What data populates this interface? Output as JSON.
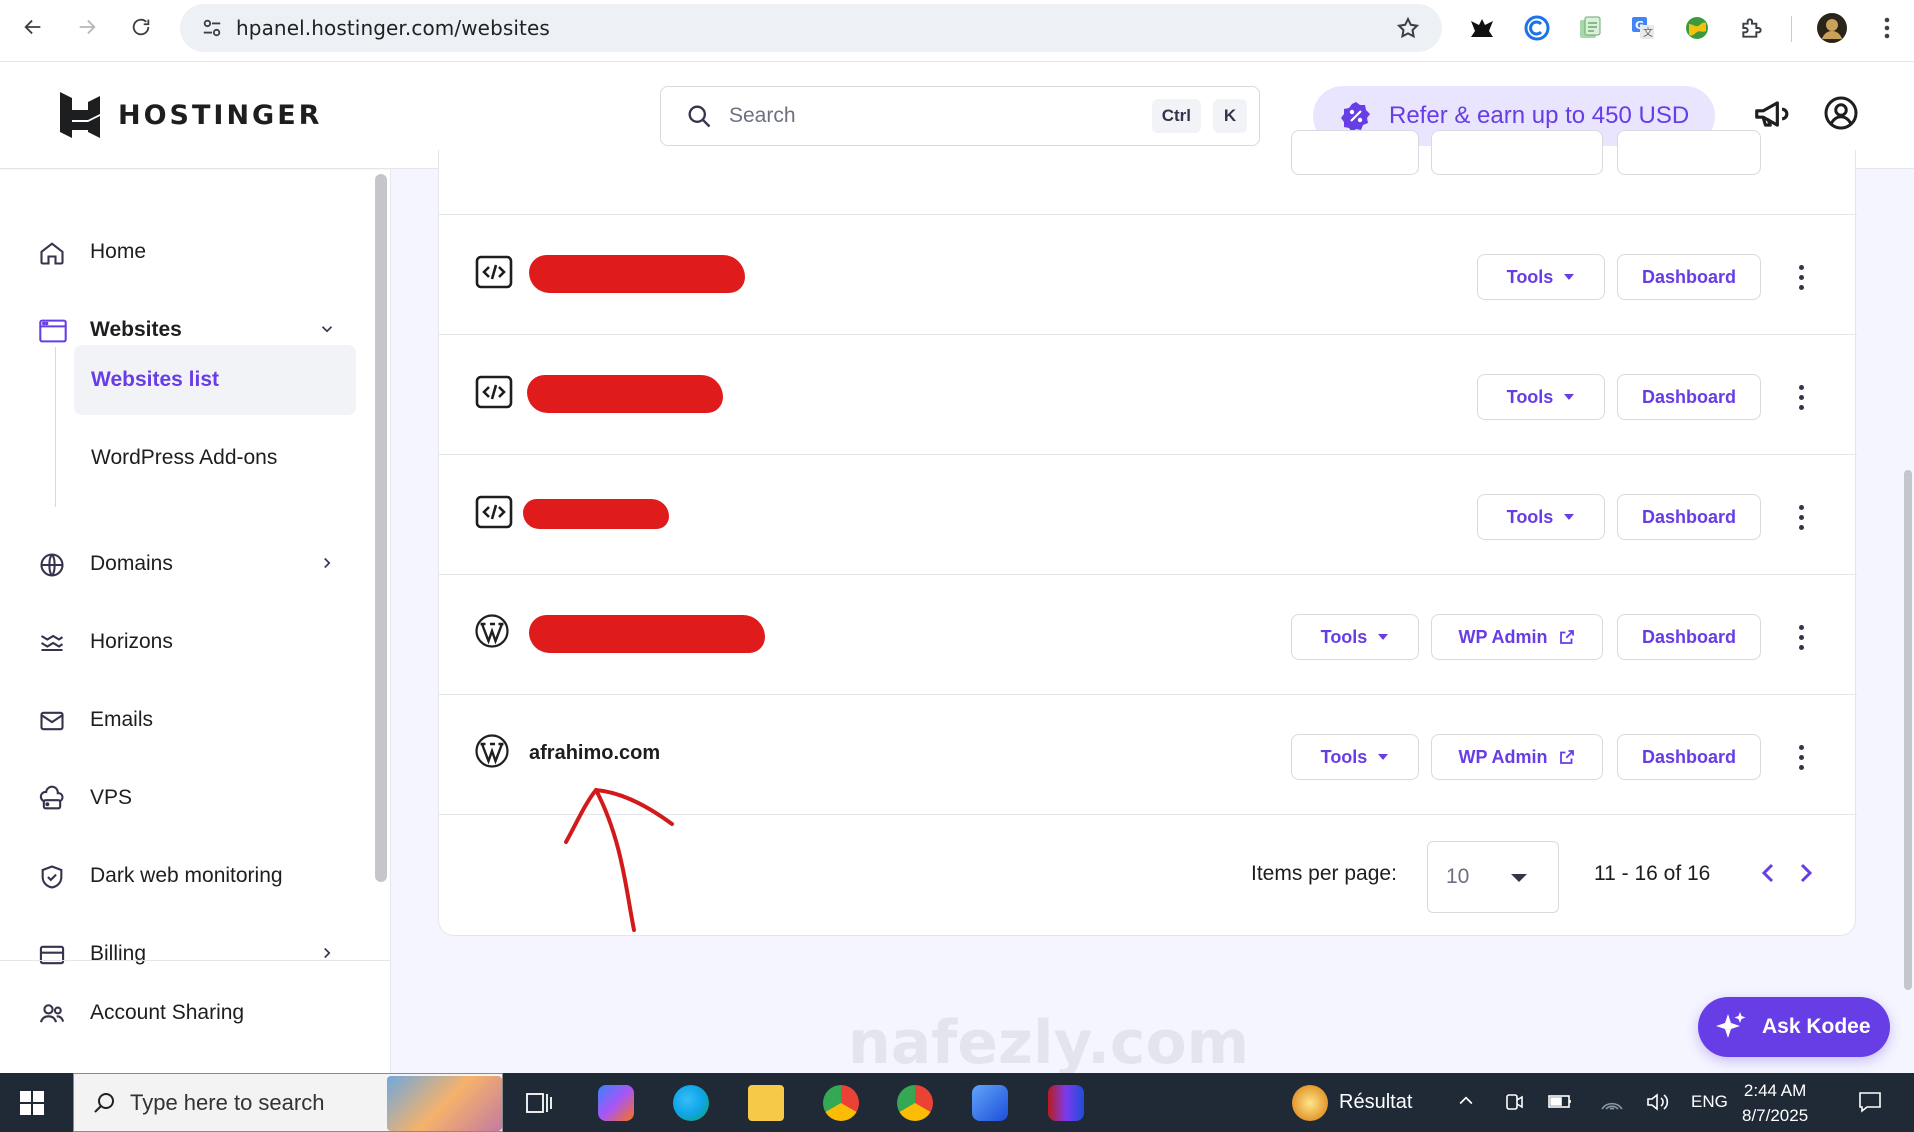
{
  "browser": {
    "url": "hpanel.hostinger.com/websites"
  },
  "header": {
    "logo_text": "HOSTINGER",
    "search_placeholder": "Search",
    "kbd_ctrl": "Ctrl",
    "kbd_k": "K",
    "refer_label": "Refer & earn up to 450 USD"
  },
  "sidebar": {
    "items": [
      {
        "label": "Home",
        "icon": "home-icon"
      },
      {
        "label": "Websites",
        "icon": "websites-icon"
      },
      {
        "label": "Domains",
        "icon": "globe-icon"
      },
      {
        "label": "Horizons",
        "icon": "horizons-icon"
      },
      {
        "label": "Emails",
        "icon": "mail-icon"
      },
      {
        "label": "VPS",
        "icon": "cloud-server-icon"
      },
      {
        "label": "Dark web monitoring",
        "icon": "shield-check-icon"
      },
      {
        "label": "Billing",
        "icon": "card-icon"
      },
      {
        "label": "Account Sharing",
        "icon": "users-icon"
      }
    ],
    "sub_items": [
      {
        "label": "Websites list"
      },
      {
        "label": "WordPress Add-ons"
      }
    ]
  },
  "websites": {
    "rows": [
      {
        "type": "custom",
        "name": ""
      },
      {
        "type": "custom",
        "name": ""
      },
      {
        "type": "custom",
        "name": ""
      },
      {
        "type": "wordpress",
        "name": ""
      },
      {
        "type": "wordpress",
        "name": "afrahimo.com"
      }
    ],
    "tools_label": "Tools",
    "wp_admin_label": "WP Admin",
    "dashboard_label": "Dashboard"
  },
  "pagination": {
    "items_per_page_label": "Items per page:",
    "items_per_page_value": "10",
    "range_text": "11 - 16 of 16"
  },
  "assistant": {
    "label": "Ask Kodee"
  },
  "watermark": "nafezly.com",
  "taskbar": {
    "search_placeholder": "Type here to search",
    "weather_label": "Résultat",
    "language": "ENG",
    "time": "2:44 AM",
    "date": "8/7/2025"
  },
  "colors": {
    "brand": "#673de6",
    "redaction": "#e01b1b",
    "annotation": "#d31a1a"
  }
}
